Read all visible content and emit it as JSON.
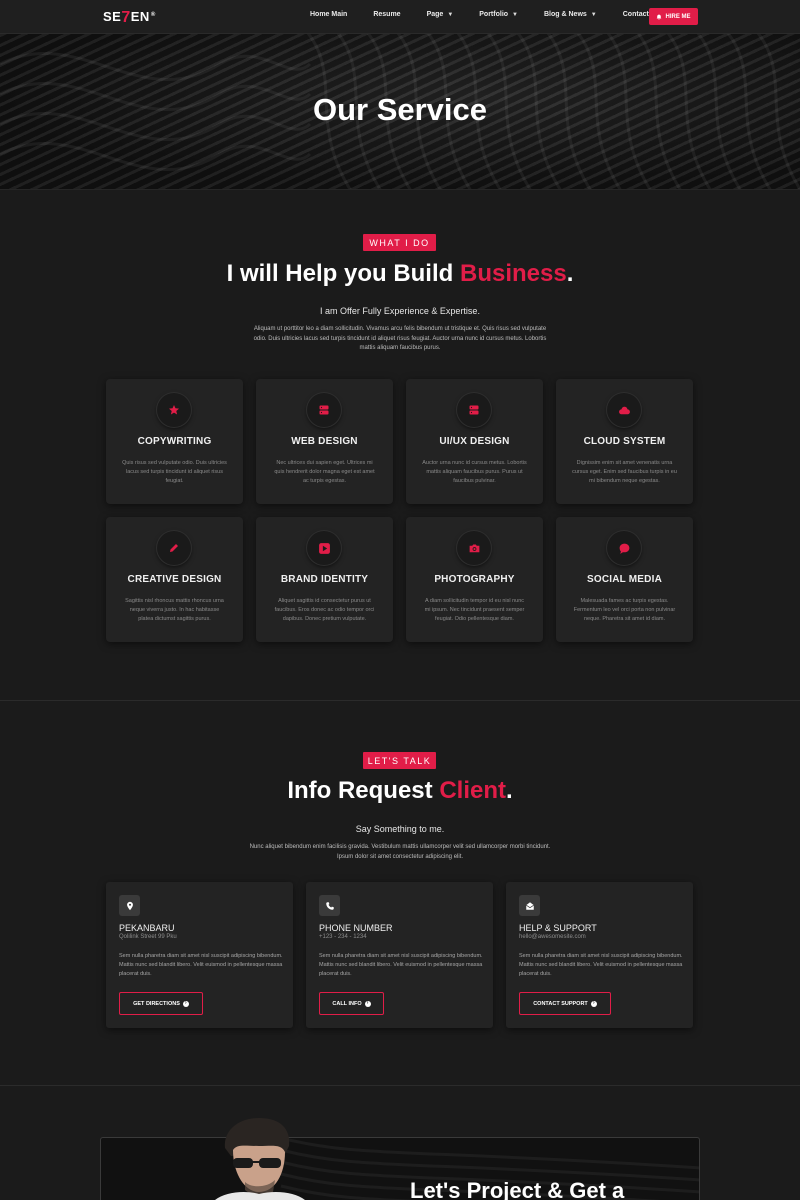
{
  "nav": {
    "logo_left": "SE",
    "logo_seven": "7",
    "logo_right": "EN",
    "logo_reg": "®",
    "items": [
      {
        "label": "Home Main",
        "has_caret": false
      },
      {
        "label": "Resume",
        "has_caret": false
      },
      {
        "label": "Page",
        "has_caret": true
      },
      {
        "label": "Portfolio",
        "has_caret": true
      },
      {
        "label": "Blog & News",
        "has_caret": true
      },
      {
        "label": "Contact",
        "has_caret": false
      }
    ],
    "hire_label": "HIRE ME",
    "hire_icon": "bell-icon"
  },
  "hero": {
    "title": "Our Service"
  },
  "services_section": {
    "tag": "WHAT I DO",
    "headline_main": "I will Help you Build",
    "headline_accent": "Business",
    "headline_dot": ".",
    "subtitle": "I am Offer Fully Experience & Expertise.",
    "paragraph": "Aliquam ut porttitor leo a diam sollicitudin. Vivamus arcu felis bibendum ut tristique et. Quis risus sed vulputate odio. Duis ultricies lacus sed turpis tincidunt id aliquet risus feugiat. Auctor urna nunc id cursus metus. Lobortis mattis aliquam faucibus purus.",
    "cards": [
      {
        "title": "COPYWRITING",
        "icon": "star-icon",
        "desc": "Quis risus sed vulputate odio. Duis ultricies lacus sed turpis tincidunt id aliquet risus feugiat."
      },
      {
        "title": "WEB DESIGN",
        "icon": "server-icon",
        "desc": "Nec ultrices dui sapien eget. Ultrices mi quis hendrerit dolor magna eget est amet ac turpis egestas."
      },
      {
        "title": "UI/UX DESIGN",
        "icon": "server-icon",
        "desc": "Auctor urna nunc id cursus metus. Lobortis mattis aliquam faucibus purus. Purus ut faucibus pulvinar."
      },
      {
        "title": "CLOUD SYSTEM",
        "icon": "cloud-icon",
        "desc": "Dignissim enim sit amet venenatis urna cursus eget. Enim sed faucibus turpis in eu mi bibendum neque egestas."
      },
      {
        "title": "CREATIVE DESIGN",
        "icon": "pencil-icon",
        "desc": "Sagittis nisl rhoncus mattis rhoncus urna neque viverra justo. In hac habitasse platea dictumst sagittis purus."
      },
      {
        "title": "BRAND IDENTITY",
        "icon": "play-icon",
        "desc": "Aliquet sagittis id consectetur purus ut faucibus. Eros donec ac odio tempor orci dapibus. Donec pretium vulputate."
      },
      {
        "title": "PHOTOGRAPHY",
        "icon": "camera-icon",
        "desc": "A diam sollicitudin tempor id eu nisl nunc mi ipsum. Nec tincidunt praesent semper feugiat. Odio pellentesque diam."
      },
      {
        "title": "SOCIAL MEDIA",
        "icon": "chat-icon",
        "desc": "Malesuada fames ac turpis egestas. Fermentum leo vel orci porta non pulvinar neque. Pharetra sit amet id diam."
      }
    ]
  },
  "contact_section": {
    "tag": "LET'S TALK",
    "headline_main": "Info Request",
    "headline_accent": "Client",
    "headline_dot": ".",
    "subtitle": "Say Something to me.",
    "paragraph": "Nunc aliquet bibendum enim facilisis gravida. Vestibulum mattis ullamcorper velit sed ullamcorper morbi tincidunt. Ipsum dolor sit amet consectetur adipiscing elit.",
    "cards": [
      {
        "title": "PEKANBARU",
        "sub": "Qolilink Street 99 Pku",
        "icon": "location-pin-icon",
        "desc": "Sem nulla pharetra diam sit amet nisl suscipit adipiscing bibendum. Mattis nunc sed blandit libero. Velit euismod in pellentesque massa placerat duis.",
        "button": "GET DIRECTIONS"
      },
      {
        "title": "PHONE NUMBER",
        "sub": "+123 - 234 - 1234",
        "icon": "phone-icon",
        "desc": "Sem nulla pharetra diam sit amet nisl suscipit adipiscing bibendum. Mattis nunc sed blandit libero. Velit euismod in pellentesque massa placerat duis.",
        "button": "CALL INFO"
      },
      {
        "title": "HELP & SUPPORT",
        "sub": "hello@awesomesite.com",
        "icon": "envelope-open-icon",
        "desc": "Sem nulla pharetra diam sit amet nisl suscipit adipiscing bibendum. Mattis nunc sed blandit libero. Velit euismod in pellentesque massa placerat duis.",
        "button": "CONTACT SUPPORT"
      }
    ]
  },
  "project_banner": {
    "title": "Let's Project & Get a"
  },
  "colors": {
    "accent": "#e11d48",
    "background": "#1b1b1b",
    "card": "#232323"
  }
}
